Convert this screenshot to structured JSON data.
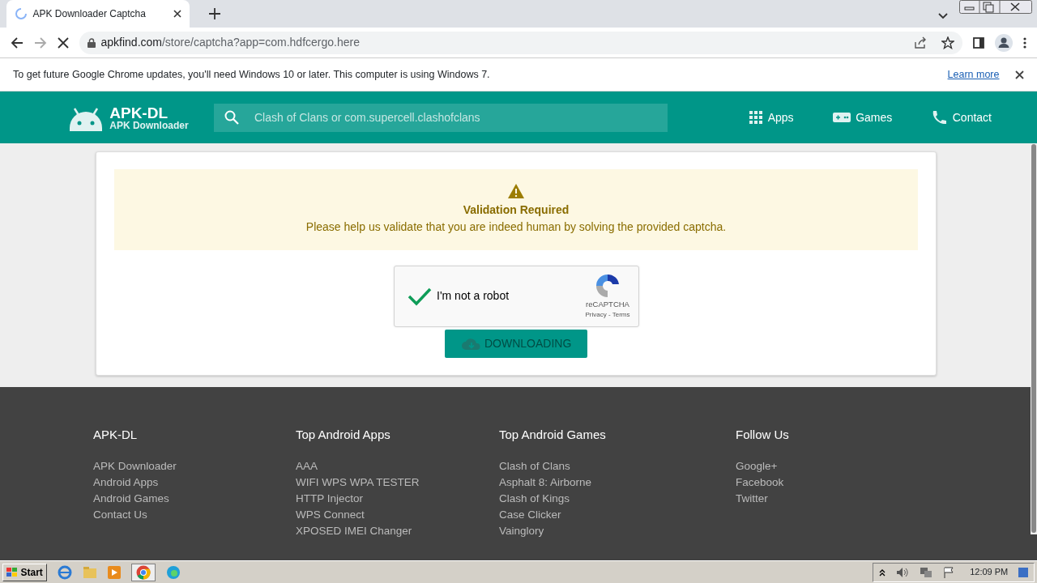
{
  "browser": {
    "tab_title": "APK Downloader Captcha",
    "url_host": "apkfind.com",
    "url_path": "/store/captcha?app=com.hdfcergo.here",
    "loading": true
  },
  "infobar": {
    "message": "To get future Google Chrome updates, you'll need Windows 10 or later. This computer is using Windows 7.",
    "link": "Learn more"
  },
  "site_header": {
    "logo_title": "APK-DL",
    "logo_subtitle": "APK Downloader",
    "search": {
      "placeholder": "Clash of Clans or com.supercell.clashofclans"
    },
    "nav": [
      {
        "kind": "apps",
        "label": "Apps"
      },
      {
        "kind": "games",
        "label": "Games"
      },
      {
        "kind": "contact",
        "label": "Contact"
      }
    ]
  },
  "alert": {
    "title": "Validation Required",
    "message": "Please help us validate that you are indeed human by solving the provided captcha."
  },
  "captcha": {
    "label": "I'm not a robot",
    "checked": true,
    "brand": "reCAPTCHA",
    "links": "Privacy - Terms"
  },
  "download_button": {
    "label": "DOWNLOADING",
    "disabled": true
  },
  "footer": {
    "columns": [
      {
        "title": "APK-DL",
        "links": [
          "APK Downloader",
          "Android Apps",
          "Android Games",
          "Contact Us"
        ]
      },
      {
        "title": "Top Android Apps",
        "links": [
          "AAA",
          "WIFI WPS WPA TESTER",
          "HTTP Injector",
          "WPS Connect",
          "XPOSED IMEI Changer"
        ]
      },
      {
        "title": "Top Android Games",
        "links": [
          "Clash of Clans",
          "Asphalt 8: Airborne",
          "Clash of Kings",
          "Case Clicker",
          "Vainglory"
        ]
      },
      {
        "title": "Follow Us",
        "links": [
          "Google+",
          "Facebook",
          "Twitter"
        ]
      }
    ]
  },
  "taskbar": {
    "start": "Start",
    "clock": "12:09 PM"
  }
}
